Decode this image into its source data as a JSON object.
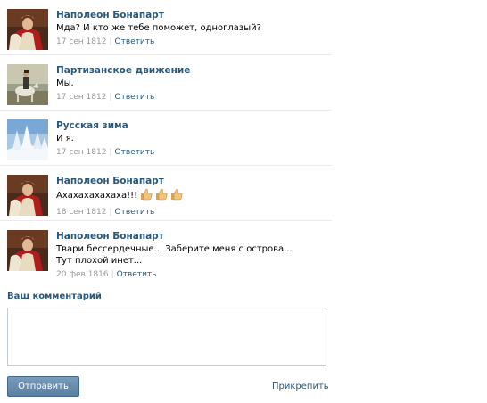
{
  "comments": [
    {
      "author": "Наполеон Бонапарт",
      "text": "Мда? И кто же тебе поможет, одноглазый?",
      "date": "17 сен 1812",
      "reply": "Ответить",
      "avatar": "napoleon-portrait"
    },
    {
      "author": "Партизанское движение",
      "text": "Мы.",
      "date": "17 сен 1812",
      "reply": "Ответить",
      "avatar": "partisan-painting"
    },
    {
      "author": "Русская зима",
      "text": "И я.",
      "date": "17 сен 1812",
      "reply": "Ответить",
      "avatar": "winter-landscape"
    },
    {
      "author": "Наполеон Бонапарт",
      "text": "Ахахахахахаха!!!",
      "emoji": [
        "thumbs-up-icon",
        "thumbs-up-icon",
        "thumbs-up-icon"
      ],
      "date": "18 сен 1812",
      "reply": "Ответить",
      "avatar": "napoleon-portrait"
    },
    {
      "author": "Наполеон Бонапарт",
      "text": "Твари бессердечные... Заберите меня с острова...\nТут плохой инет...",
      "date": "20 фев 1816",
      "reply": "Ответить",
      "avatar": "napoleon-portrait"
    }
  ],
  "form": {
    "title": "Ваш комментарий",
    "value": "",
    "send_label": "Отправить",
    "attach_label": "Прикрепить"
  },
  "colors": {
    "link": "#2b587a",
    "button": "#5f85a7",
    "meta": "#999999"
  }
}
